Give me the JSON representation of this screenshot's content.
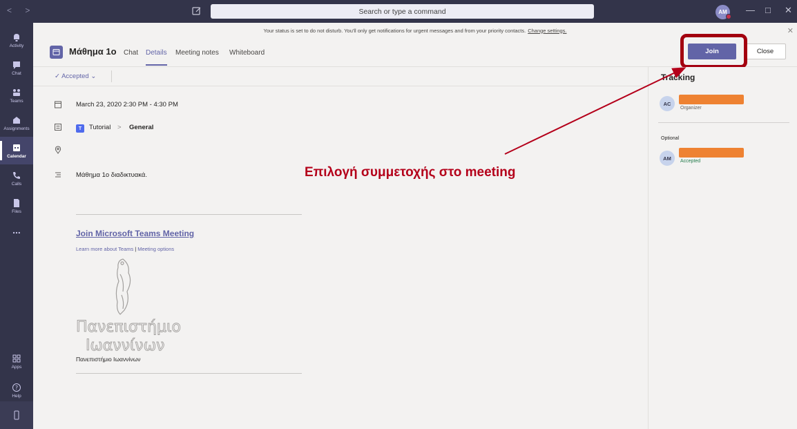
{
  "titlebar": {
    "search_placeholder": "Search or type a command",
    "user_initials": "AM"
  },
  "rail": {
    "items": [
      {
        "label": "Activity",
        "icon": "bell-icon"
      },
      {
        "label": "Chat",
        "icon": "chat-icon"
      },
      {
        "label": "Teams",
        "icon": "teams-icon"
      },
      {
        "label": "Assignments",
        "icon": "assignments-icon"
      },
      {
        "label": "Calendar",
        "icon": "calendar-icon"
      },
      {
        "label": "Calls",
        "icon": "phone-icon"
      },
      {
        "label": "Files",
        "icon": "file-icon"
      },
      {
        "label": "...",
        "icon": "more-icon"
      },
      {
        "label": "Apps",
        "icon": "apps-icon"
      },
      {
        "label": "Help",
        "icon": "help-icon"
      }
    ]
  },
  "banner": {
    "text": "Your status is set to do not disturb. You'll only get notifications for urgent messages and from your priority contacts.",
    "link": "Change settings."
  },
  "header": {
    "title": "Μάθημα 1ο",
    "tabs": [
      "Chat",
      "Details",
      "Meeting notes",
      "Whiteboard"
    ],
    "active_tab": "Details",
    "join_label": "Join",
    "close_label": "Close"
  },
  "subbar": {
    "response": "Accepted"
  },
  "details": {
    "datetime": "March 23, 2020 2:30 PM - 4:30 PM",
    "team_badge": "T",
    "team": "Tutorial",
    "channel": "General",
    "description": "Μάθημα 1ο διαδικτυακά.",
    "join_link": "Join Microsoft Teams Meeting",
    "learn_more": "Learn more about Teams",
    "meeting_options": "Meeting options",
    "logo_line1": "Πανεπιστήμιο",
    "logo_line2": "Ιωαννίνων",
    "university": "Πανεπιστήμιο Ιωαννίνων"
  },
  "tracking": {
    "title": "Tracking",
    "organizer_initials": "AC",
    "organizer_role": "Organizer",
    "optional_label": "Optional",
    "attendee_initials": "AM",
    "attendee_status": "Accepted"
  },
  "annotation": {
    "text": "Επιλογή συμμετοχής στο meeting",
    "color": "#b4001a"
  },
  "colors": {
    "rail": "#33344a",
    "accent": "#6264a7",
    "redaction": "#ee8232"
  }
}
